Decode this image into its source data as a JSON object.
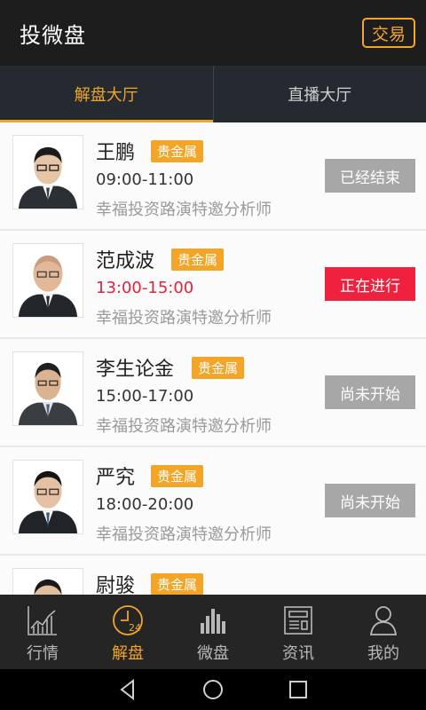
{
  "header": {
    "title": "投微盘",
    "trade_label": "交易"
  },
  "tabs": [
    {
      "label": "解盘大厅",
      "active": true
    },
    {
      "label": "直播大厅",
      "active": false
    }
  ],
  "analysts": [
    {
      "name": "王鹏",
      "tag": "贵金属",
      "time": "09:00-11:00",
      "desc": "幸福投资路演特邀分析师",
      "status": "已经结束",
      "live": false
    },
    {
      "name": "范成波",
      "tag": "贵金属",
      "time": "13:00-15:00",
      "desc": "幸福投资路演特邀分析师",
      "status": "正在进行",
      "live": true
    },
    {
      "name": "李生论金",
      "tag": "贵金属",
      "time": "15:00-17:00",
      "desc": "幸福投资路演特邀分析师",
      "status": "尚未开始",
      "live": false
    },
    {
      "name": "严究",
      "tag": "贵金属",
      "time": "18:00-20:00",
      "desc": "幸福投资路演特邀分析师",
      "status": "尚未开始",
      "live": false
    },
    {
      "name": "尉骏",
      "tag": "贵金属",
      "time": "",
      "desc": "",
      "status": "",
      "live": false
    }
  ],
  "bottom_nav": [
    {
      "label": "行情",
      "icon": "market-chart-icon",
      "active": false
    },
    {
      "label": "解盘",
      "icon": "clock-24-icon",
      "active": true
    },
    {
      "label": "微盘",
      "icon": "bar-chart-icon",
      "active": false
    },
    {
      "label": "资讯",
      "icon": "news-icon",
      "active": false
    },
    {
      "label": "我的",
      "icon": "user-icon",
      "active": false
    }
  ],
  "colors": {
    "accent": "#f2a526",
    "live": "#f0213f",
    "header_bg": "#1d1d1d"
  }
}
